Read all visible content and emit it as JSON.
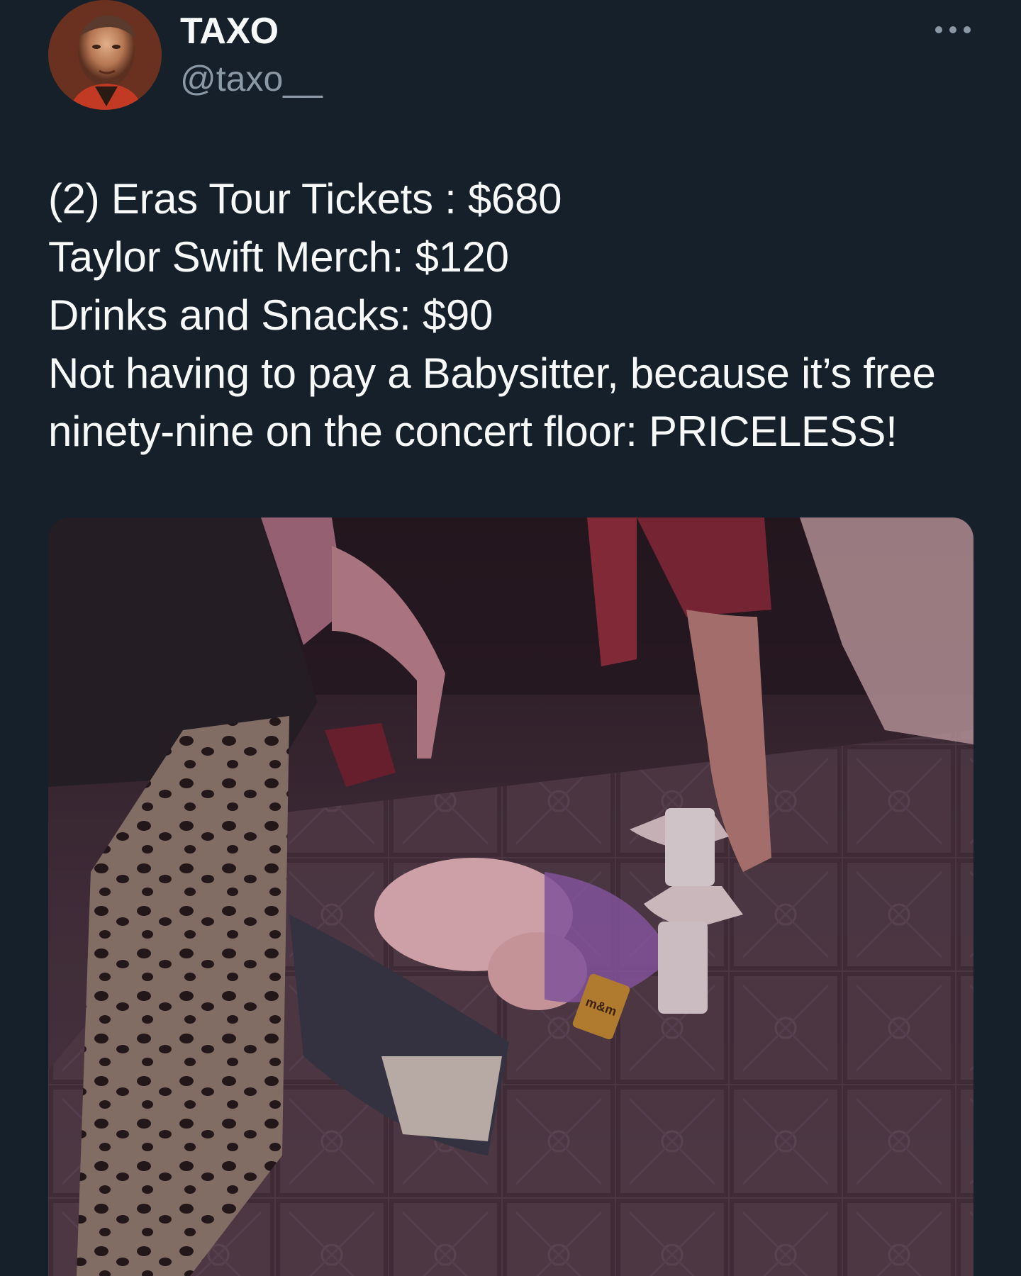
{
  "author": {
    "display_name": "TAXO",
    "handle": "@taxo__",
    "avatar_icon": "profile-photo-icon"
  },
  "menu": {
    "more_icon": "more-dots-icon"
  },
  "tweet": {
    "lines": [
      "(2) Eras Tour Tickets : $680",
      "Taylor Swift Merch: $120",
      "Drinks and Snacks: $90",
      "Not having to pay a Babysitter, because it’s free",
      "ninety-nine on the concert floor: PRICELESS!"
    ]
  },
  "media": {
    "type": "photo",
    "snack_wrapper_text": "m&m"
  },
  "colors": {
    "background": "#15202b",
    "text_primary": "#f7f9f9",
    "text_secondary": "#8b98a5"
  }
}
